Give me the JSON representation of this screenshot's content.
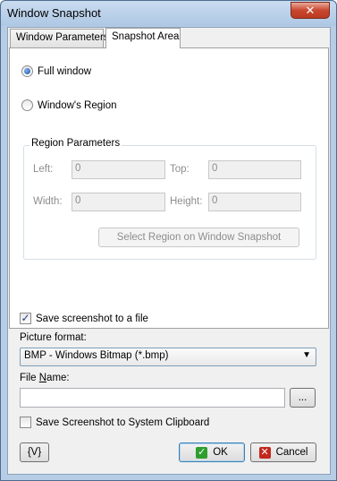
{
  "window": {
    "title": "Window Snapshot",
    "close_glyph": "✕"
  },
  "tabs": [
    {
      "label": "Window Parameters",
      "active": false
    },
    {
      "label": "Snapshot Area",
      "active": true
    }
  ],
  "area": {
    "full_window_label": "Full window",
    "full_window_checked": true,
    "windows_region_label": "Window's Region",
    "windows_region_checked": false
  },
  "region": {
    "group_title": "Region Parameters",
    "left_label": "Left:",
    "left_value": "0",
    "top_label": "Top:",
    "top_value": "0",
    "width_label": "Width:",
    "width_value": "0",
    "height_label": "Height:",
    "height_value": "0",
    "select_button_label": "Select Region on Window Snapshot"
  },
  "save": {
    "save_to_file_label": "Save screenshot to a file",
    "save_to_file_checked": true,
    "picture_format_label": "Picture format:",
    "picture_format_value": "BMP - Windows Bitmap (*.bmp)",
    "file_name_label_prefix": "File ",
    "file_name_label_accel": "N",
    "file_name_label_suffix": "ame:",
    "file_name_value": "",
    "browse_label": "...",
    "clipboard_label": "Save Screenshot to System Clipboard",
    "clipboard_checked": false
  },
  "footer": {
    "variables_label": "{V}",
    "ok_label": "OK",
    "cancel_label": "Cancel"
  },
  "icons": {
    "ok_icon": "check-icon",
    "cancel_icon": "cross-icon",
    "dropdown_icon": "chevron-down-icon"
  }
}
